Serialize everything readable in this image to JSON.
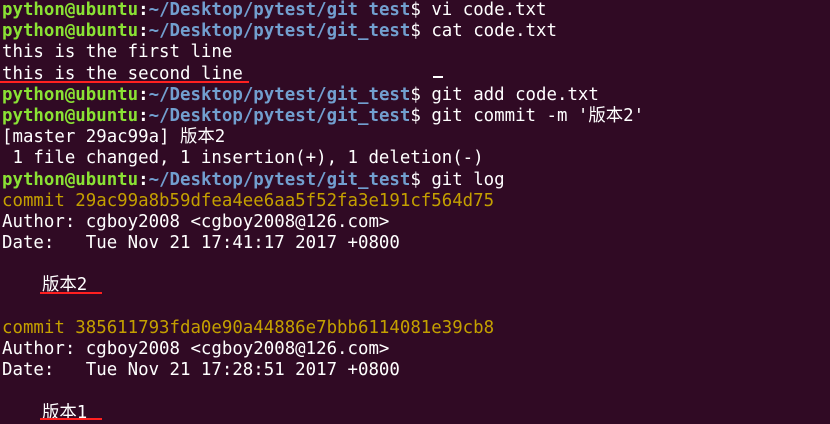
{
  "prompt": {
    "user": "python@ubuntu",
    "separator": ":",
    "path_line1": "~/Desktop/pytest/git test",
    "path": "~/Desktop/pytest/git_test",
    "dollar": "$"
  },
  "lines": {
    "l1_cmd": " vi code.txt",
    "l2_cmd": " cat code.txt",
    "l3_out": "this is the first line",
    "l4_out": "this is the second line",
    "l5_cmd": " git add code.txt",
    "l6_cmd": " git commit -m '版本2'",
    "l7_out": "[master 29ac99a] 版本2",
    "l8_out": " 1 file changed, 1 insertion(+), 1 deletion(-)",
    "l9_cmd": " git log"
  },
  "commits": [
    {
      "hash_line": "commit 29ac99a8b59dfea4ee6aa5f52fa3e191cf564d75",
      "author_line": "Author: cgboy2008 <cgboy2008@126.com>",
      "date_line": "Date:   Tue Nov 21 17:41:17 2017 +0800",
      "message": "版本2"
    },
    {
      "hash_line": "commit 385611793fda0e90a44886e7bbb6114081e39cb8",
      "author_line": "Author: cgboy2008 <cgboy2008@126.com>",
      "date_line": "Date:   Tue Nov 21 17:28:51 2017 +0800",
      "message": "版本1"
    }
  ],
  "colors": {
    "background": "#300a24",
    "prompt_user": "#8ae234",
    "prompt_path": "#729fcf",
    "commit_hash": "#c4a000",
    "annotation_underline": "#ff2020"
  }
}
